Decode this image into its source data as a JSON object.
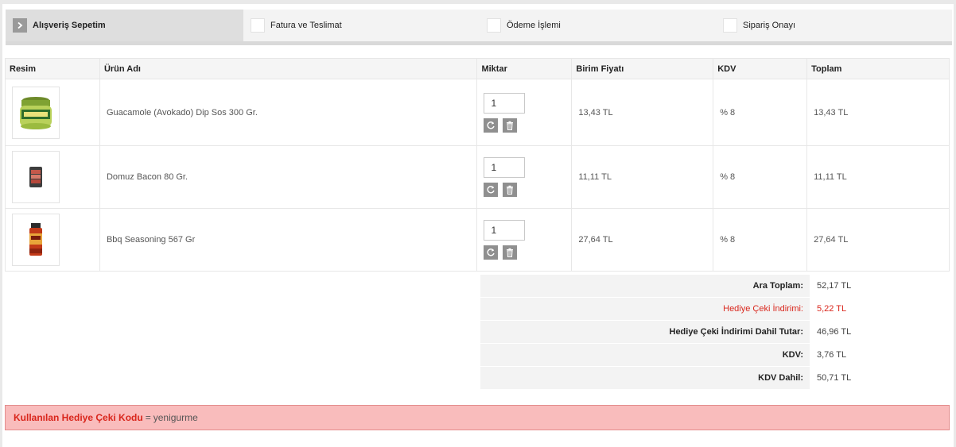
{
  "steps": [
    {
      "label": "Alışveriş Sepetim",
      "active": true,
      "icon": "chevron-right-icon"
    },
    {
      "label": "Fatura ve Teslimat",
      "active": false
    },
    {
      "label": "Ödeme İşlemi",
      "active": false
    },
    {
      "label": "Sipariş Onayı",
      "active": false
    }
  ],
  "table": {
    "headers": {
      "image": "Resim",
      "product": "Ürün Adı",
      "quantity": "Miktar",
      "unit_price": "Birim Fiyatı",
      "tax": "KDV",
      "total": "Toplam"
    },
    "rows": [
      {
        "name": "Guacamole (Avokado) Dip Sos 300 Gr.",
        "qty": "1",
        "unit_price": "13,43 TL",
        "tax": "% 8",
        "total": "13,43 TL",
        "image": "guacamole-jar"
      },
      {
        "name": "Domuz Bacon 80 Gr.",
        "qty": "1",
        "unit_price": "11,11 TL",
        "tax": "% 8",
        "total": "11,11 TL",
        "image": "bacon-pack"
      },
      {
        "name": "Bbq Seasoning 567 Gr",
        "qty": "1",
        "unit_price": "27,64 TL",
        "tax": "% 8",
        "total": "27,64 TL",
        "image": "bbq-seasoning-bottle"
      }
    ],
    "icons": {
      "update": "refresh-icon",
      "delete": "trash-icon"
    }
  },
  "summary": [
    {
      "label": "Ara Toplam:",
      "value": "52,17 TL",
      "highlight": false
    },
    {
      "label": "Hediye Çeki İndirimi:",
      "value": "5,22 TL",
      "highlight": true
    },
    {
      "label": "Hediye Çeki İndirimi Dahil Tutar:",
      "value": "46,96 TL",
      "highlight": false
    },
    {
      "label": "KDV:",
      "value": "3,76 TL",
      "highlight": false
    },
    {
      "label": "KDV Dahil:",
      "value": "50,71 TL",
      "highlight": false
    }
  ],
  "gift": {
    "label": "Kullanılan Hediye Çeki Kodu",
    "separator": "=",
    "code": "yenigurme"
  },
  "colors": {
    "accent_red": "#d9261c",
    "gift_bg": "#f9bcbc",
    "active_step_bg": "#dedede",
    "icon_gray": "#8f8f8f"
  }
}
